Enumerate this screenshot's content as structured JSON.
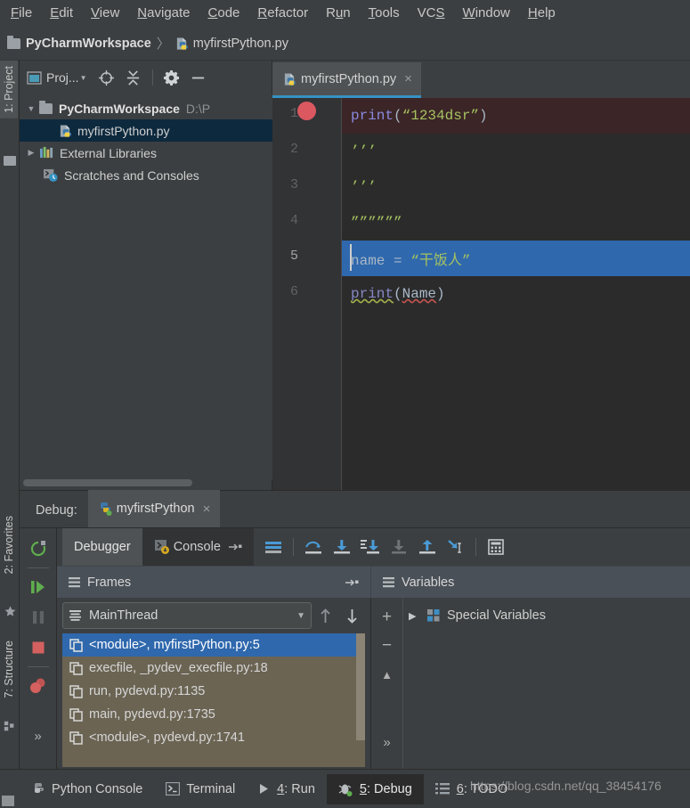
{
  "menubar": {
    "items": [
      {
        "label": "File",
        "mnemonic": "F"
      },
      {
        "label": "Edit",
        "mnemonic": "E"
      },
      {
        "label": "View",
        "mnemonic": "V"
      },
      {
        "label": "Navigate",
        "mnemonic": "N"
      },
      {
        "label": "Code",
        "mnemonic": "C"
      },
      {
        "label": "Refactor",
        "mnemonic": "R"
      },
      {
        "label": "Run",
        "mnemonic": "u"
      },
      {
        "label": "Tools",
        "mnemonic": "T"
      },
      {
        "label": "VCS",
        "mnemonic": "S"
      },
      {
        "label": "Window",
        "mnemonic": "W"
      },
      {
        "label": "Help",
        "mnemonic": "H"
      }
    ]
  },
  "breadcrumb": {
    "project": "PyCharmWorkspace",
    "separator": "〉",
    "file": "myfirstPython.py"
  },
  "left_strip": {
    "project_tab": "1: Project",
    "favorites_tab": "2: Favorites",
    "structure_tab": "7: Structure"
  },
  "project_panel": {
    "toolbar": {
      "view_label": "Proj...",
      "locate_icon": "target-icon",
      "collapse_icon": "collapse-all-icon",
      "settings_icon": "gear-icon",
      "hide_icon": "minimize-icon"
    },
    "tree": [
      {
        "label": "PyCharmWorkspace",
        "path": "D:\\P",
        "icon": "folder-icon",
        "expanded": true,
        "bold": true,
        "selected": false,
        "indent": 0
      },
      {
        "label": "myfirstPython.py",
        "path": "",
        "icon": "python-file-icon",
        "expanded": null,
        "bold": false,
        "selected": true,
        "indent": 2
      },
      {
        "label": "External Libraries",
        "path": "",
        "icon": "library-icon",
        "expanded": false,
        "bold": false,
        "selected": false,
        "indent": 0
      },
      {
        "label": "Scratches and Consoles",
        "path": "",
        "icon": "scratches-icon",
        "expanded": null,
        "bold": false,
        "selected": false,
        "indent": 1
      }
    ]
  },
  "editor": {
    "tab": {
      "label": "myfirstPython.py",
      "close": "×",
      "icon": "python-file-icon"
    },
    "breakpoint_line": 1,
    "caret_line": 5,
    "lines": [
      {
        "number": "1",
        "state": "error-bg",
        "tokens": [
          {
            "t": "print",
            "c": "kw-fn"
          },
          {
            "t": "(",
            "c": "punct"
          },
          {
            "t": "“1234dsr”",
            "c": "str"
          },
          {
            "t": ")",
            "c": "punct"
          }
        ]
      },
      {
        "number": "2",
        "state": "",
        "tokens": [
          {
            "t": "’’’",
            "c": "str"
          }
        ]
      },
      {
        "number": "3",
        "state": "",
        "tokens": [
          {
            "t": "’’’",
            "c": "str"
          }
        ]
      },
      {
        "number": "4",
        "state": "",
        "tokens": [
          {
            "t": "””””””",
            "c": "str"
          }
        ]
      },
      {
        "number": "5",
        "state": "selected",
        "tokens": [
          {
            "t": "name ",
            "c": "ident"
          },
          {
            "t": "= ",
            "c": "punct"
          },
          {
            "t": "“干饭人”",
            "c": "str"
          }
        ]
      },
      {
        "number": "6",
        "state": "",
        "tokens": [
          {
            "t": "print",
            "c": "kw-fn2 sq-green"
          },
          {
            "t": "(",
            "c": "punct"
          },
          {
            "t": "Name",
            "c": "ident sq-red"
          },
          {
            "t": ")",
            "c": "punct"
          }
        ]
      }
    ]
  },
  "debug_window": {
    "title": "Debug:",
    "session_tab": {
      "label": "myfirstPython",
      "close": "×",
      "icon": "python-run-icon"
    },
    "controls": [
      {
        "name": "rerun-button",
        "icon": "rerun-icon"
      },
      {
        "name": "resume-button",
        "icon": "resume-icon"
      },
      {
        "name": "pause-button",
        "icon": "pause-icon"
      },
      {
        "name": "stop-button",
        "icon": "stop-icon"
      },
      {
        "name": "view-breakpoints-button",
        "icon": "breakpoints-icon"
      },
      {
        "name": "more-button",
        "icon": "chevron-double-right-icon"
      }
    ],
    "tabs": [
      {
        "label": "Debugger",
        "selected": true,
        "icon": ""
      },
      {
        "label": "Console",
        "selected": false,
        "icon": "console-icon"
      }
    ],
    "toolbar_buttons": [
      {
        "name": "show-all-frames-button",
        "icon": "lines-icon"
      },
      {
        "name": "step-over-button",
        "icon": "step-over-icon"
      },
      {
        "name": "step-into-button",
        "icon": "step-into-icon"
      },
      {
        "name": "step-into-my-code-button",
        "icon": "step-into-my-code-icon"
      },
      {
        "name": "force-step-into-button",
        "icon": "force-step-into-icon"
      },
      {
        "name": "step-out-button",
        "icon": "step-out-icon"
      },
      {
        "name": "run-to-cursor-button",
        "icon": "run-to-cursor-icon"
      },
      {
        "name": "evaluate-expression-button",
        "icon": "calculator-icon"
      }
    ],
    "frames": {
      "header": "Frames",
      "thread": "MainThread",
      "items": [
        {
          "label": "<module>, myfirstPython.py:5",
          "selected": true
        },
        {
          "label": "execfile, _pydev_execfile.py:18",
          "selected": false
        },
        {
          "label": "run, pydevd.py:1135",
          "selected": false
        },
        {
          "label": "main, pydevd.py:1735",
          "selected": false
        },
        {
          "label": "<module>, pydevd.py:1741",
          "selected": false
        }
      ]
    },
    "variables": {
      "header": "Variables",
      "items": [
        {
          "label": "Special Variables",
          "expandable": true,
          "icon": "special-variables-icon"
        }
      ],
      "controls": [
        "+",
        "−",
        "▲",
        "»"
      ]
    }
  },
  "statusbar": {
    "items": [
      {
        "label": "Python Console",
        "mnemonic": "",
        "icon": "python-console-icon",
        "selected": false
      },
      {
        "label": "Terminal",
        "mnemonic": "",
        "icon": "terminal-icon",
        "selected": false
      },
      {
        "label": "4: Run",
        "mnemonic": "4",
        "icon": "run-icon",
        "selected": false
      },
      {
        "label": "5: Debug",
        "mnemonic": "5",
        "icon": "debug-icon",
        "selected": true
      },
      {
        "label": "6: TODO",
        "mnemonic": "6",
        "icon": "todo-icon",
        "selected": false
      }
    ]
  },
  "watermark": {
    "text": "https://blog.csdn.net/qq_38454176"
  },
  "colors": {
    "window_bg": "#3c3f41",
    "editor_bg": "#2b2b2b",
    "gutter_bg": "#313335",
    "selection_blue": "#2f68ad",
    "tab_underline": "#3592c4",
    "tree_selected": "#0d293e",
    "error_line_bg": "#3b2526",
    "breakpoint_red": "#db5860",
    "string_green": "#a5c261",
    "frames_bg": "#6b6453"
  }
}
